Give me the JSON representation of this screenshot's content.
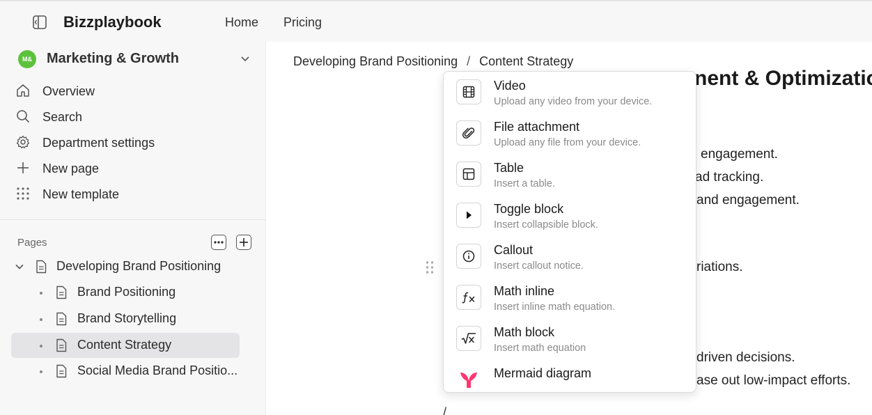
{
  "topbar": {
    "brand": "Bizzplaybook",
    "nav": [
      "Home",
      "Pricing"
    ]
  },
  "sidebar": {
    "department": {
      "avatar": "M&",
      "name": "Marketing & Growth"
    },
    "menu": [
      {
        "label": "Overview",
        "icon": "home-icon"
      },
      {
        "label": "Search",
        "icon": "search-icon"
      },
      {
        "label": "Department settings",
        "icon": "gear-icon"
      },
      {
        "label": "New page",
        "icon": "plus-icon"
      },
      {
        "label": "New template",
        "icon": "grid-icon"
      }
    ],
    "pages_label": "Pages",
    "pages": [
      {
        "label": "Developing Brand Positioning"
      },
      {
        "label": "Brand Positioning"
      },
      {
        "label": "Brand Storytelling"
      },
      {
        "label": "Content Strategy"
      },
      {
        "label": "Social Media Brand Positio..."
      }
    ]
  },
  "main": {
    "breadcrumb": [
      "Developing Brand Positioning",
      "Content Strategy"
    ],
    "heading_partial": "nent & Optimizatio",
    "lines": [
      "engagement.",
      "ad tracking.",
      "and engagement.",
      "riations.",
      "driven decisions.",
      "ase out low-impact efforts."
    ],
    "slash": "/"
  },
  "popup": {
    "items": [
      {
        "title": "Video",
        "desc": "Upload any video from your device.",
        "icon": "video-icon"
      },
      {
        "title": "File attachment",
        "desc": "Upload any file from your device.",
        "icon": "paperclip-icon"
      },
      {
        "title": "Table",
        "desc": "Insert a table.",
        "icon": "table-icon"
      },
      {
        "title": "Toggle block",
        "desc": "Insert collapsible block.",
        "icon": "play-icon"
      },
      {
        "title": "Callout",
        "desc": "Insert callout notice.",
        "icon": "info-icon"
      },
      {
        "title": "Math inline",
        "desc": "Insert inline math equation.",
        "icon": "function-icon"
      },
      {
        "title": "Math block",
        "desc": "Insert math equation",
        "icon": "sqrt-icon"
      },
      {
        "title": "Mermaid diagram",
        "desc": "",
        "icon": "mermaid-icon"
      }
    ]
  },
  "colors": {
    "avatar": "#5cc23c",
    "active_page": "#e4e4e6",
    "mermaid": "#ff3670"
  }
}
